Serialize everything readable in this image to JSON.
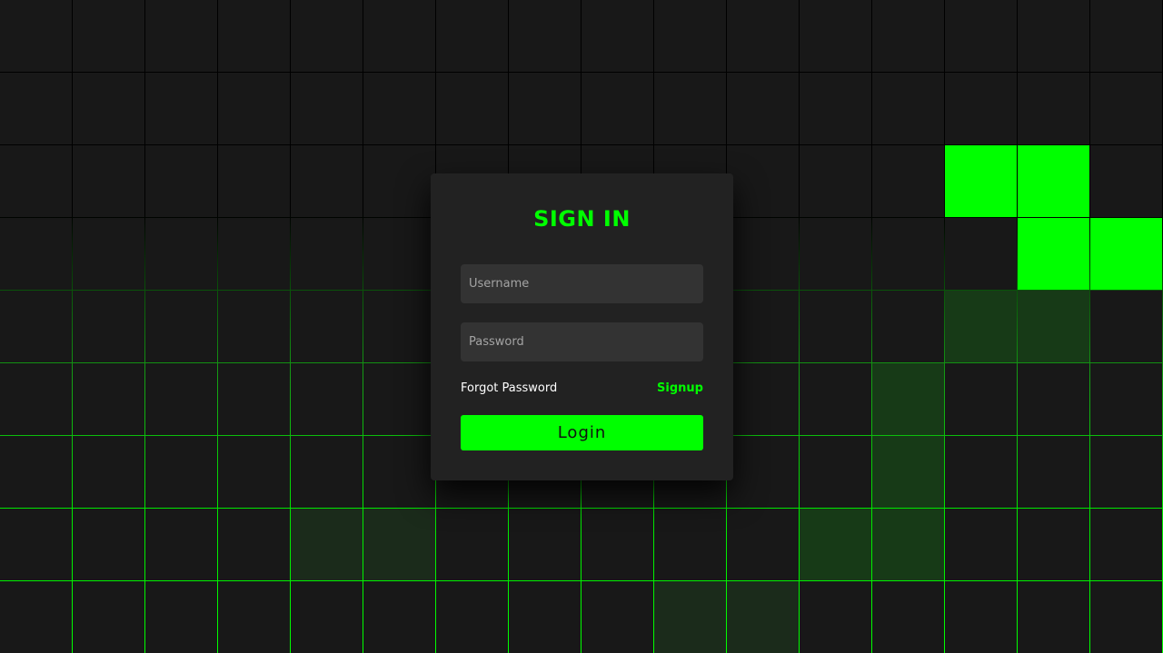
{
  "login": {
    "title": "SIGN IN",
    "username_placeholder": "Username",
    "password_placeholder": "Password",
    "forgot_label": "Forgot Password",
    "signup_label": "Signup",
    "login_label": "Login"
  },
  "theme": {
    "accent": "#00ff00",
    "background": "#181818",
    "card": "#222222",
    "input": "#333333"
  }
}
